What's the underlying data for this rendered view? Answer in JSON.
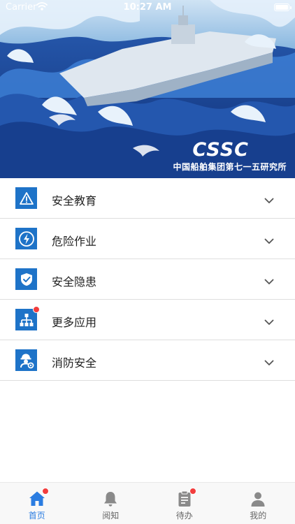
{
  "status_bar": {
    "carrier": "Carrier",
    "time": "10:27 AM"
  },
  "banner": {
    "logo_text": "CSSC",
    "caption": "中国船舶集团第七一五研究所",
    "image_desc_icon": "aircraft-carrier-ocean-illustration"
  },
  "menu": {
    "items": [
      {
        "label": "安全教育",
        "icon": "warning-triangle-icon",
        "badge": false
      },
      {
        "label": "危险作业",
        "icon": "lightning-hazard-icon",
        "badge": false
      },
      {
        "label": "安全隐患",
        "icon": "shield-check-icon",
        "badge": false
      },
      {
        "label": "更多应用",
        "icon": "org-chart-icon",
        "badge": true
      },
      {
        "label": "消防安全",
        "icon": "firefighter-gear-icon",
        "badge": false
      }
    ]
  },
  "tabbar": {
    "tabs": [
      {
        "label": "首页",
        "icon": "home-icon",
        "active": true,
        "badge": true
      },
      {
        "label": "阅知",
        "icon": "bell-icon",
        "active": false,
        "badge": false
      },
      {
        "label": "待办",
        "icon": "clipboard-icon",
        "active": false,
        "badge": true
      },
      {
        "label": "我的",
        "icon": "person-icon",
        "active": false,
        "badge": false
      }
    ]
  },
  "colors": {
    "accent": "#1e73c8",
    "tab_active": "#2b7de1",
    "badge": "#f23d3d",
    "banner_blue": "#1e4a9c"
  }
}
